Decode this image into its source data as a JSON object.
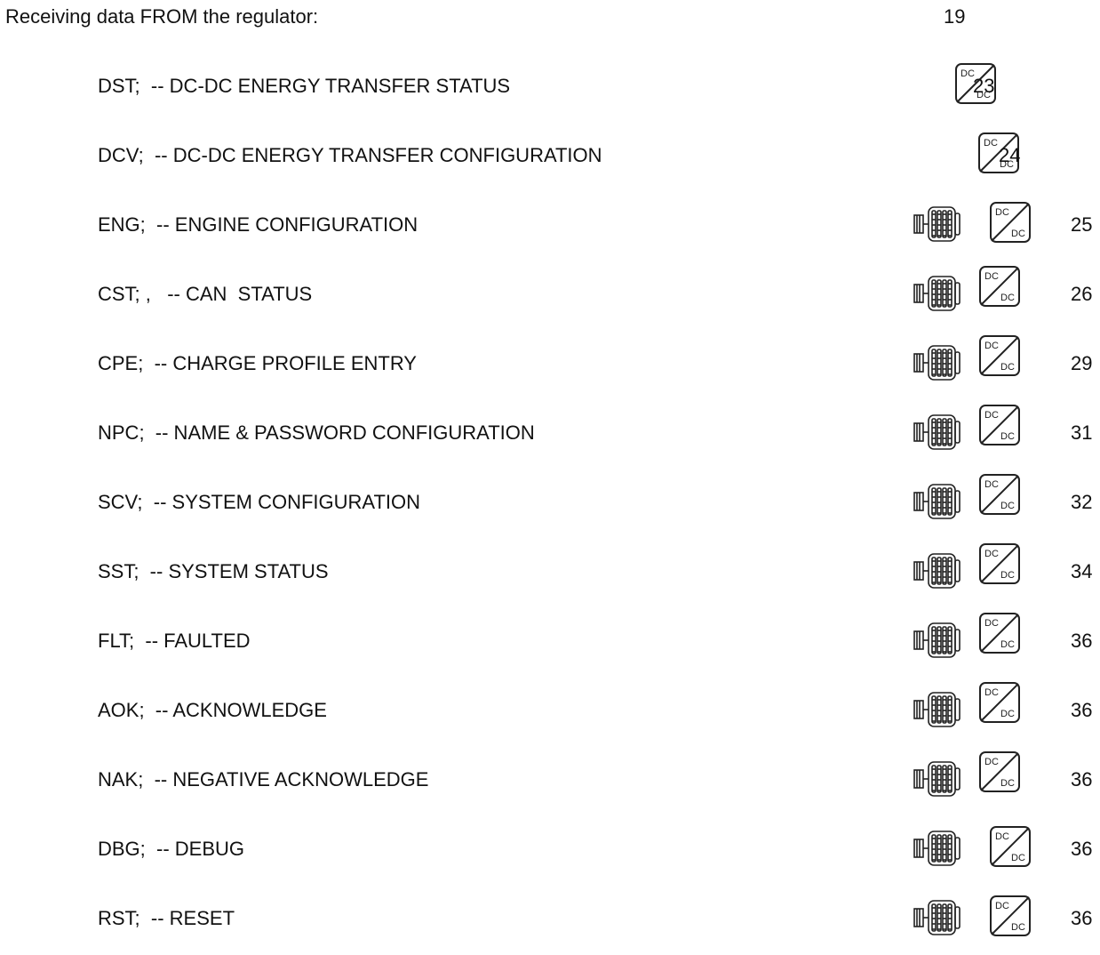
{
  "header": {
    "title": "Receiving data FROM the regulator:",
    "page": "19"
  },
  "entries": [
    {
      "label": "DST;  -- DC-DC ENERGY TRANSFER STATUS",
      "page": "23",
      "icons": [
        "dcdc-converter-icon"
      ]
    },
    {
      "label": "DCV;  -- DC-DC ENERGY TRANSFER CONFIGURATION",
      "page": "24",
      "icons": [
        "dcdc-converter-icon"
      ]
    },
    {
      "label": "ENG;  -- ENGINE CONFIGURATION",
      "page": "25",
      "icons": [
        "alternator-icon",
        "dcdc-converter-icon"
      ]
    },
    {
      "label": "CST; ,   -- CAN  STATUS",
      "page": "26",
      "icons": [
        "alternator-icon",
        "dcdc-converter-icon"
      ]
    },
    {
      "label": "CPE;  -- CHARGE PROFILE ENTRY",
      "page": "29",
      "icons": [
        "alternator-icon",
        "dcdc-converter-icon"
      ]
    },
    {
      "label": "NPC;  -- NAME & PASSWORD CONFIGURATION",
      "page": "31",
      "icons": [
        "alternator-icon",
        "dcdc-converter-icon"
      ]
    },
    {
      "label": "SCV;  -- SYSTEM CONFIGURATION",
      "page": "32",
      "icons": [
        "alternator-icon",
        "dcdc-converter-icon"
      ]
    },
    {
      "label": "SST;  -- SYSTEM STATUS",
      "page": "34",
      "icons": [
        "alternator-icon",
        "dcdc-converter-icon"
      ]
    },
    {
      "label": "FLT;  -- FAULTED",
      "page": "36",
      "icons": [
        "alternator-icon",
        "dcdc-converter-icon"
      ]
    },
    {
      "label": "AOK;  -- ACKNOWLEDGE",
      "page": "36",
      "icons": [
        "alternator-icon",
        "dcdc-converter-icon"
      ]
    },
    {
      "label": "NAK;  -- NEGATIVE ACKNOWLEDGE",
      "page": "36",
      "icons": [
        "alternator-icon",
        "dcdc-converter-icon"
      ]
    },
    {
      "label": "DBG;  -- DEBUG",
      "page": "36",
      "icons": [
        "alternator-icon",
        "dcdc-converter-icon"
      ]
    },
    {
      "label": "RST;  -- RESET",
      "page": "36",
      "icons": [
        "alternator-icon",
        "dcdc-converter-icon"
      ]
    }
  ],
  "dcdc_icon": {
    "top_text": "DC",
    "bottom_text": "DC"
  }
}
